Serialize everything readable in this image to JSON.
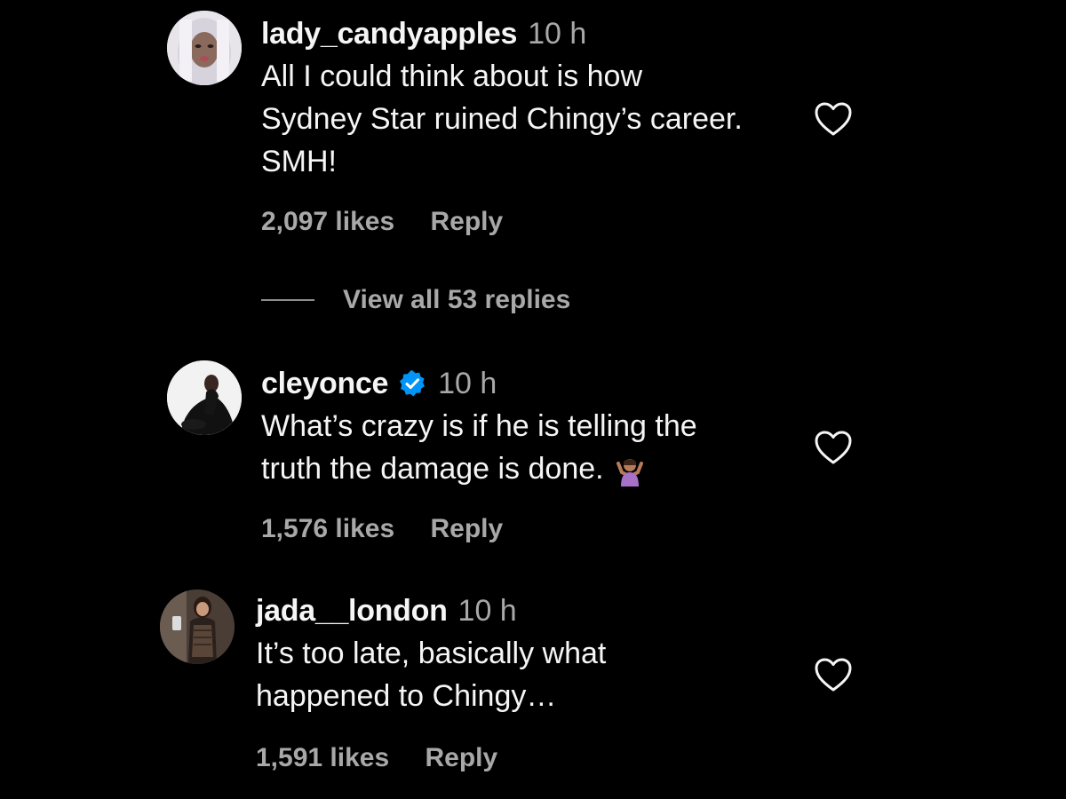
{
  "comments": [
    {
      "username": "lady_candyapples",
      "time": "10 h",
      "verified": false,
      "lines": [
        "All I could think about is how",
        "Sydney Star ruined Chingy’s career.",
        "SMH!"
      ],
      "likes": "2,097 likes",
      "reply_label": "Reply",
      "avatar_icon": "avatar-photo"
    },
    {
      "username": "cleyonce",
      "time": "10 h",
      "verified": true,
      "lines": [
        "What’s crazy is if he is telling the",
        "truth the damage is done."
      ],
      "emoji": "person-shrugging-emoji",
      "likes": "1,576 likes",
      "reply_label": "Reply",
      "avatar_icon": "avatar-photo"
    },
    {
      "username": "jada__london",
      "time": "10 h",
      "verified": false,
      "lines": [
        "It’s too late, basically what",
        "happened to Chingy…"
      ],
      "likes": "1,591 likes",
      "reply_label": "Reply",
      "avatar_icon": "avatar-photo"
    }
  ],
  "view_replies_label": "View all 53 replies",
  "colors": {
    "background": "#000000",
    "primary_text": "#f5f5f5",
    "secondary_text": "#a8a8a8",
    "verified_badge": "#0095f6"
  },
  "icons": {
    "like": "heart-outline-icon",
    "verified": "verified-badge-icon"
  }
}
